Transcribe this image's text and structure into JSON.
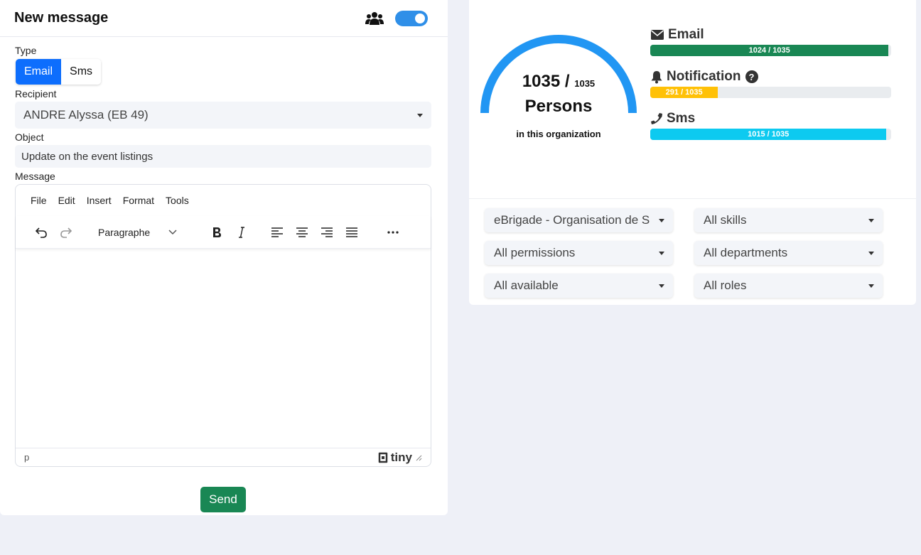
{
  "compose": {
    "title": "New message",
    "type_label": "Type",
    "types": [
      {
        "label": "Email",
        "active": true
      },
      {
        "label": "Sms",
        "active": false
      }
    ],
    "recipient_label": "Recipient",
    "recipient_value": "ANDRE Alyssa (EB 49)",
    "object_label": "Object",
    "object_value": "Update on the event listings",
    "message_label": "Message",
    "send_label": "Send"
  },
  "editor": {
    "menu": [
      "File",
      "Edit",
      "Insert",
      "Format",
      "Tools"
    ],
    "block_format": "Paragraphe",
    "status_path": "p",
    "brand": "tiny"
  },
  "stats": {
    "total": "1035 /",
    "total_of": "1035",
    "persons_label": "Persons",
    "subtitle": "in this organization",
    "channels": [
      {
        "name": "Email",
        "icon": "envelope-icon",
        "value": 1024,
        "max": 1035,
        "label": "1024 / 1035",
        "color": "#198754"
      },
      {
        "name": "Notification",
        "icon": "bell-icon",
        "value": 291,
        "max": 1035,
        "label": "291 / 1035",
        "color": "#ffc107"
      },
      {
        "name": "Sms",
        "icon": "phone-icon",
        "value": 1015,
        "max": 1035,
        "label": "1015 / 1035",
        "color": "#0dcaf0"
      }
    ],
    "gauge_color": "#2196f3"
  },
  "filters": {
    "organisation": "eBrigade - Organisation de S",
    "skills": "All skills",
    "permissions": "All permissions",
    "departments": "All departments",
    "available": "All available",
    "roles": "All roles"
  }
}
